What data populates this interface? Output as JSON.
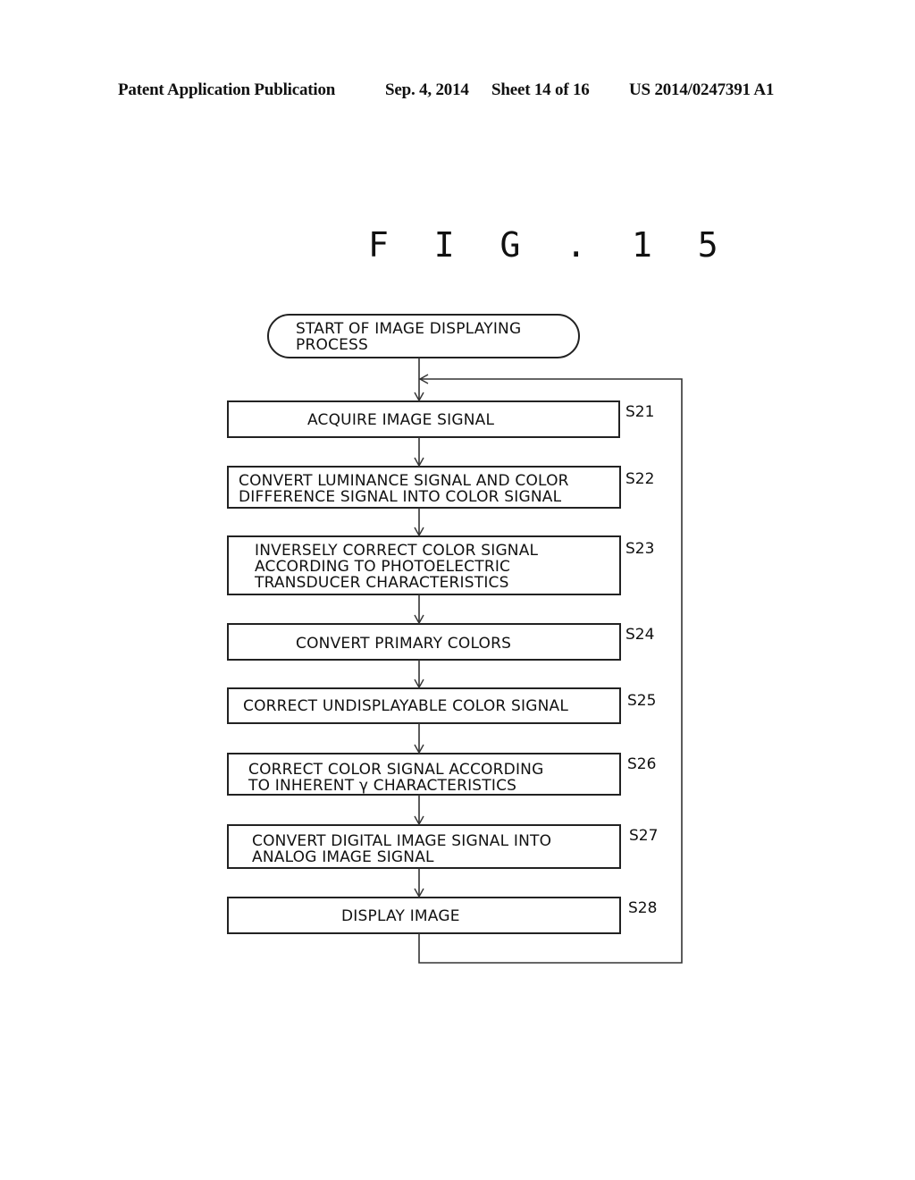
{
  "header": {
    "publication": "Patent Application Publication",
    "date": "Sep. 4, 2014",
    "sheet": "Sheet 14 of 16",
    "number": "US 2014/0247391 A1"
  },
  "figure": {
    "title": "F I G . 1 5"
  },
  "flowchart": {
    "start": {
      "lines": [
        "START OF IMAGE DISPLAYING",
        "PROCESS"
      ]
    },
    "steps": [
      {
        "label": "S21",
        "lines": [
          "ACQUIRE IMAGE SIGNAL"
        ]
      },
      {
        "label": "S22",
        "lines": [
          "CONVERT LUMINANCE SIGNAL AND COLOR",
          "DIFFERENCE SIGNAL INTO COLOR SIGNAL"
        ]
      },
      {
        "label": "S23",
        "lines": [
          "INVERSELY CORRECT COLOR SIGNAL",
          "ACCORDING TO PHOTOELECTRIC",
          "TRANSDUCER CHARACTERISTICS"
        ]
      },
      {
        "label": "S24",
        "lines": [
          "CONVERT PRIMARY COLORS"
        ]
      },
      {
        "label": "S25",
        "lines": [
          "CORRECT UNDISPLAYABLE COLOR SIGNAL"
        ]
      },
      {
        "label": "S26",
        "lines": [
          "CORRECT COLOR SIGNAL ACCORDING",
          "TO INHERENT γ CHARACTERISTICS"
        ]
      },
      {
        "label": "S27",
        "lines": [
          "CONVERT DIGITAL IMAGE SIGNAL INTO",
          "ANALOG IMAGE SIGNAL"
        ]
      },
      {
        "label": "S28",
        "lines": [
          "DISPLAY IMAGE"
        ]
      }
    ]
  }
}
